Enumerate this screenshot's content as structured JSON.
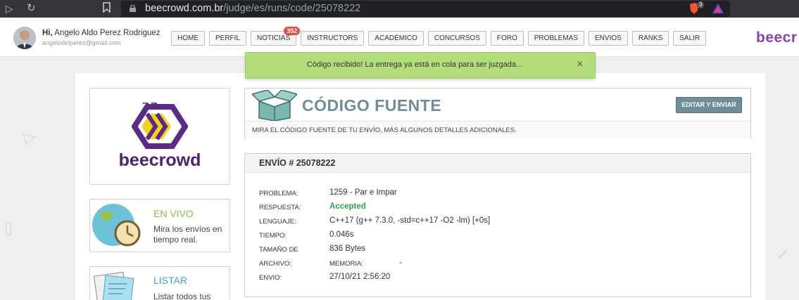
{
  "browser": {
    "url_domain": "beecrowd.com.br",
    "url_path": "/judge/es/runs/code/25078222",
    "brave_badge": "3"
  },
  "header": {
    "greeting": "Hi,",
    "user_name": "Angelo Aldo Perez Rodriguez",
    "user_email": "angelodelperez@gmail.com",
    "brand": "beecr",
    "menu": [
      {
        "label": "HOME"
      },
      {
        "label": "PERFIL"
      },
      {
        "label": "NOTICIAS",
        "badge": "352"
      },
      {
        "label": "INSTRUCTORS"
      },
      {
        "label": "ACADÉMICO"
      },
      {
        "label": "CONCURSOS"
      },
      {
        "label": "FORO"
      },
      {
        "label": "PROBLEMAS"
      },
      {
        "label": "ENVIOS"
      },
      {
        "label": "RANKS"
      },
      {
        "label": "SALIR"
      }
    ]
  },
  "toast": {
    "message": "Código recibido! La entrega ya está en cola para ser juzgada...",
    "close": "×"
  },
  "sidebar": {
    "logo_text": "beecrowd",
    "live": {
      "title": "EN VIVO",
      "desc": "Mira los envíos en tiempo real.",
      "title_color": "#8bbf2f"
    },
    "list": {
      "title": "LISTAR",
      "desc": "Listar todos tus",
      "title_color": "#3aa6c9"
    }
  },
  "source": {
    "title": "CÓDIGO FUENTE",
    "subtitle": "MIRA EL CÓDIGO FUENTE DE TU ENVÍO, MÁS ALGUNOS DETALLES ADICIONALES.",
    "edit_button": "EDITAR Y ENVIAR"
  },
  "run": {
    "header": "ENVÍO # 25078222",
    "problem_label": "PROBLEMA:",
    "problem_value": "1259 - Par e Impar",
    "answer_label": "RESPUESTA:",
    "answer_value": "Accepted",
    "answer_color": "#2ea84a",
    "language_label": "LENGUAJE:",
    "language_value": "C++17 (g++ 7.3.0, -std=c++17 -O2 -lm) [+0s]",
    "time_label": "TIEMPO:",
    "time_value": "0.046s",
    "size_label": "TAMAÑO DE",
    "size_value": "836 Bytes",
    "file_label": "ARCHIVO:",
    "memory_label": "MEMORIA:",
    "memory_value": "-",
    "sent_label": "ENVIO:",
    "sent_value": "27/10/21 2:56:20"
  }
}
